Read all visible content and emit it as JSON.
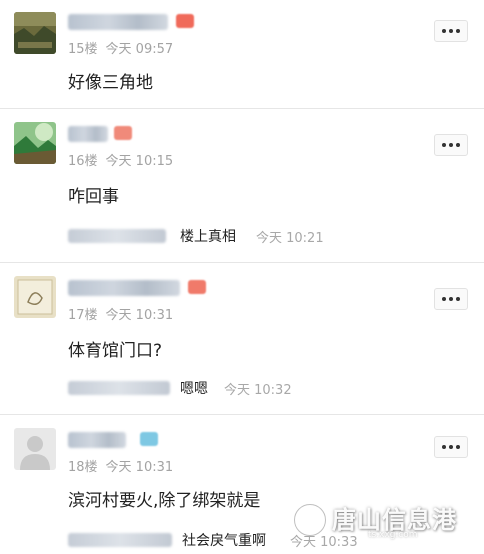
{
  "posts": [
    {
      "floor": "15楼",
      "time": "今天 09:57",
      "content": "好像三角地",
      "avatar_icon": "landscape-photo-avatar",
      "badge_color": "#f06a5a"
    },
    {
      "floor": "16楼",
      "time": "今天 10:15",
      "content": "咋回事",
      "avatar_icon": "green-landscape-avatar",
      "badge_color": "#f08a7a",
      "reply": {
        "text": "楼上真相",
        "time": "今天 10:21"
      }
    },
    {
      "floor": "17楼",
      "time": "今天 10:31",
      "content": "体育馆门口?",
      "avatar_icon": "beige-sketch-avatar",
      "badge_color": "#f07a6a",
      "reply": {
        "text": "嗯嗯",
        "time": "今天 10:32"
      }
    },
    {
      "floor": "18楼",
      "time": "今天 10:31",
      "content": "滨河村要火,除了绑架就是",
      "avatar_icon": "default-user-avatar",
      "badge_color": "#7ec8e3",
      "reply": {
        "text": "社会戾气重啊",
        "time": "今天 10:33"
      }
    }
  ],
  "watermark": {
    "title": "唐山信息港",
    "subtitle": "ts.xxg.com"
  }
}
